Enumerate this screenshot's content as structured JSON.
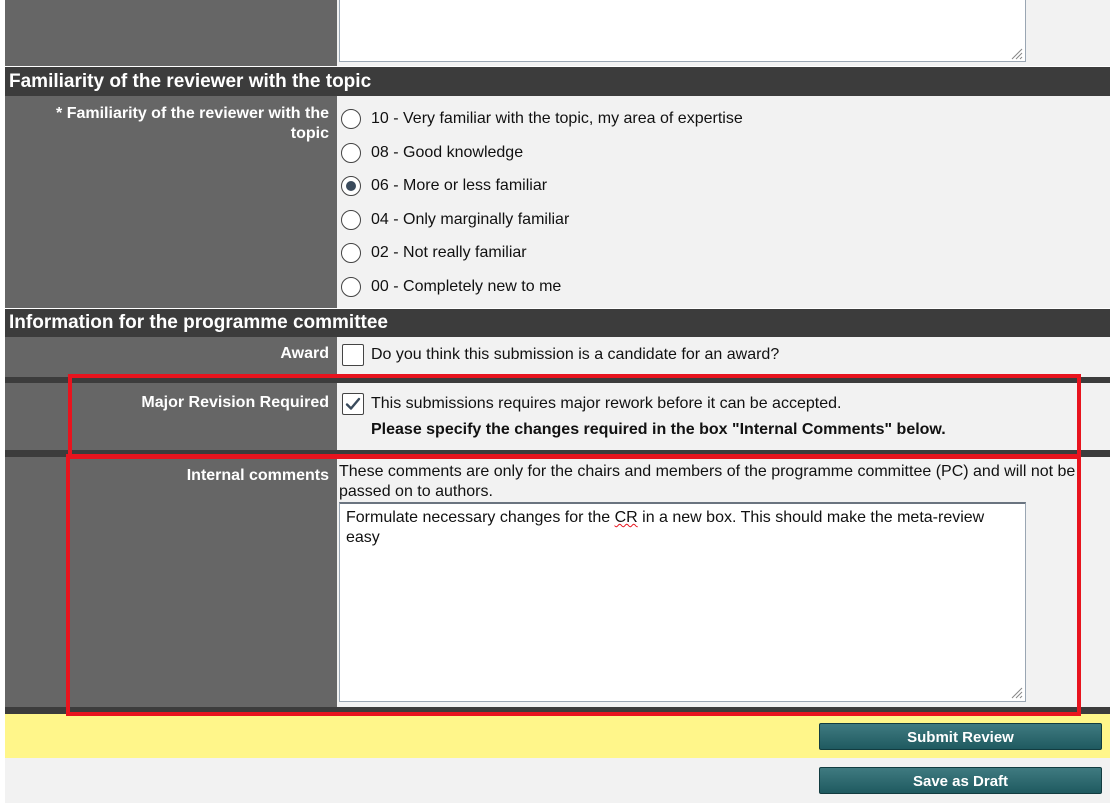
{
  "sections": {
    "familiarity_heading": "Familiarity of the reviewer with the topic",
    "committee_heading": "Information for the programme committee"
  },
  "familiarity": {
    "label": "* Familiarity of the reviewer with the topic",
    "options": [
      {
        "label": "10 - Very familiar with the topic, my area of expertise",
        "selected": false
      },
      {
        "label": "08 - Good knowledge",
        "selected": false
      },
      {
        "label": "06 - More or less familiar",
        "selected": true
      },
      {
        "label": "04 - Only marginally familiar",
        "selected": false
      },
      {
        "label": "02 - Not really familiar",
        "selected": false
      },
      {
        "label": "00 - Completely new to me",
        "selected": false
      }
    ]
  },
  "award": {
    "label": "Award",
    "checkbox_text": "Do you think this submission is a candidate for an award?",
    "checked": false
  },
  "major_revision": {
    "label": "Major Revision Required",
    "checkbox_text": "This submissions requires major rework before it can be accepted.",
    "note": "Please specify the changes required in the box \"Internal Comments\" below.",
    "checked": true
  },
  "internal_comments": {
    "label": "Internal comments",
    "description": "These comments are only for the chairs and members of the programme committee (PC) and will not be passed on to authors.",
    "text_before": "Formulate necessary changes for the ",
    "text_misspelled": "CR",
    "text_after": " in a new box. This should make the meta-review easy"
  },
  "buttons": {
    "submit": "Submit Review",
    "draft": "Save as Draft"
  },
  "colors": {
    "label_bg": "#666666",
    "section_bg": "#3c3c3c",
    "highlight": "#e8141e",
    "footer_yellow": "#fff68a",
    "button": "#2c6a70"
  }
}
